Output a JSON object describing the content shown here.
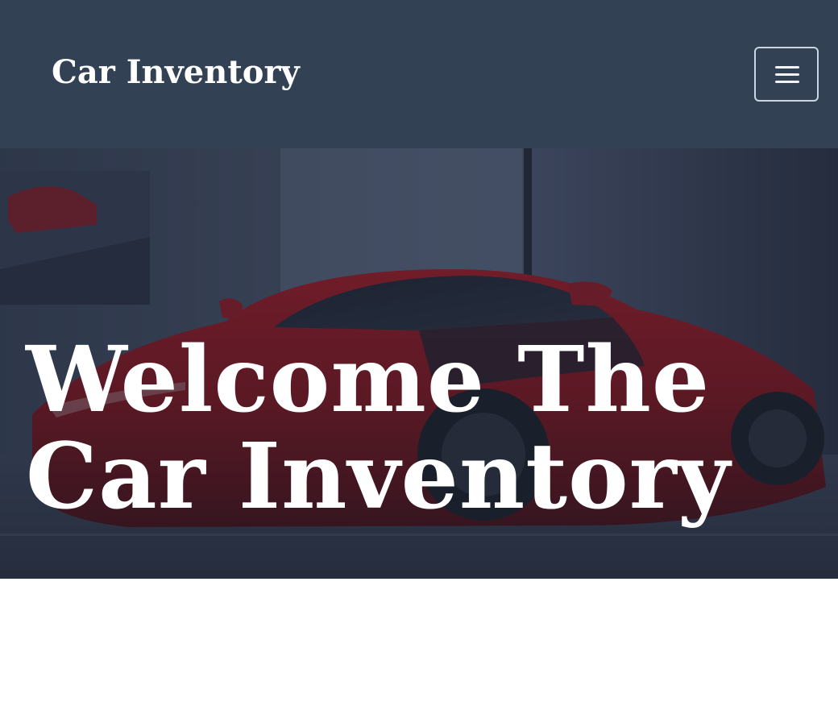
{
  "navbar": {
    "brand": "Car Inventory",
    "menu_icon": "hamburger-icon",
    "background": "#334155"
  },
  "hero": {
    "title": "Welcome The Car Inventory",
    "image": "red-sports-car-in-showroom",
    "overlay_color": "#1e293b"
  }
}
